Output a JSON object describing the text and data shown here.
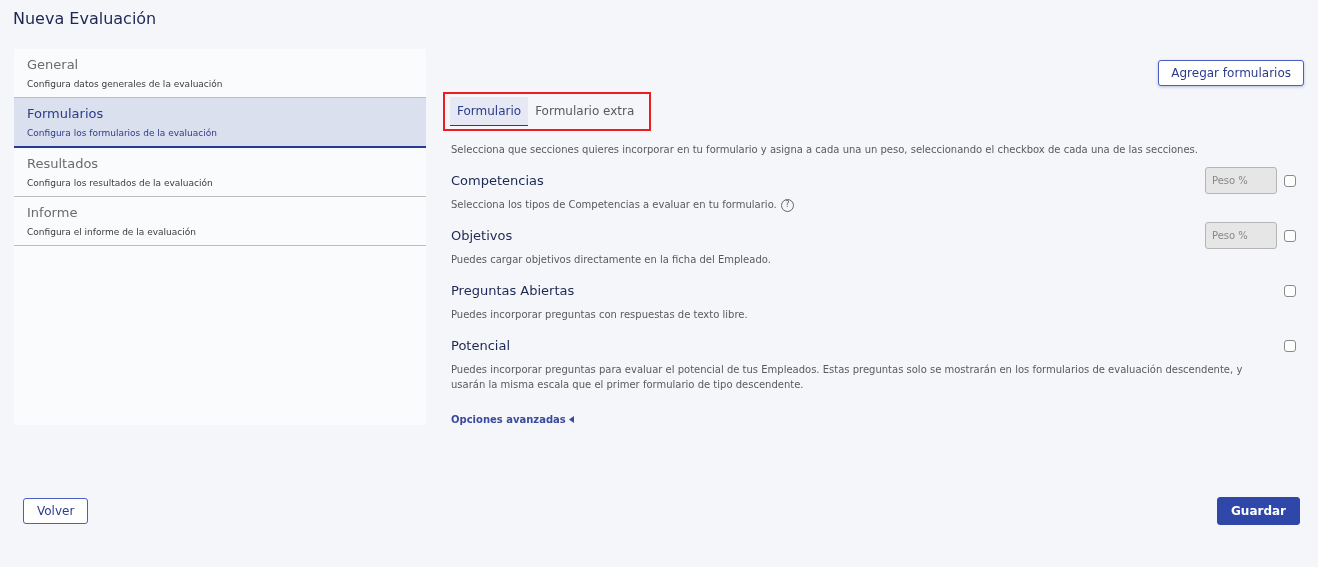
{
  "title": "Nueva Evaluación",
  "steps": [
    {
      "label": "General",
      "description": "Configura datos generales de la evaluación",
      "selected": false
    },
    {
      "label": "Formularios",
      "description": "Configura los formularios de la evaluación",
      "selected": true
    },
    {
      "label": "Resultados",
      "description": "Configura los resultados de la evaluación",
      "selected": false
    },
    {
      "label": "Informe",
      "description": "Configura el informe de la evaluación",
      "selected": false
    }
  ],
  "add_button": "Agregar formularios",
  "tabs_highlighted": true,
  "tabs": [
    {
      "label": "Formulario",
      "selected": true
    },
    {
      "label": "Formulario extra",
      "selected": false
    }
  ],
  "intro": "Selecciona que secciones quieres incorporar en tu formulario y asigna a cada una un peso, seleccionando el checkbox de cada una de las secciones.",
  "sections": [
    {
      "kind": "weighted",
      "title": "Competencias",
      "description": "Selecciona los tipos de Competencias a evaluar en tu formulario.",
      "help": "?",
      "weight_placeholder": "Peso %",
      "weight_disabled": true,
      "checked": false
    },
    {
      "kind": "weighted",
      "title": "Objetivos",
      "description": "Puedes cargar objetivos directamente en la ficha del Empleado.",
      "weight_placeholder": "Peso %",
      "weight_disabled": true,
      "checked": false
    },
    {
      "kind": "plain",
      "title": "Preguntas Abiertas",
      "description": "Puedes incorporar preguntas con respuestas de texto libre.",
      "checked": false
    },
    {
      "kind": "plain",
      "title": "Potencial",
      "description": "Puedes incorporar preguntas para evaluar el potencial de tus Empleados. Estas preguntas solo se mostrarán en los formularios de evaluación descendente, y usarán la misma escala que el primer formulario de tipo descendente.",
      "checked": false
    }
  ],
  "advanced": {
    "label": "Opciones avanzadas",
    "expanded": false
  },
  "back_button": "Volver",
  "save_button": "Guardar"
}
